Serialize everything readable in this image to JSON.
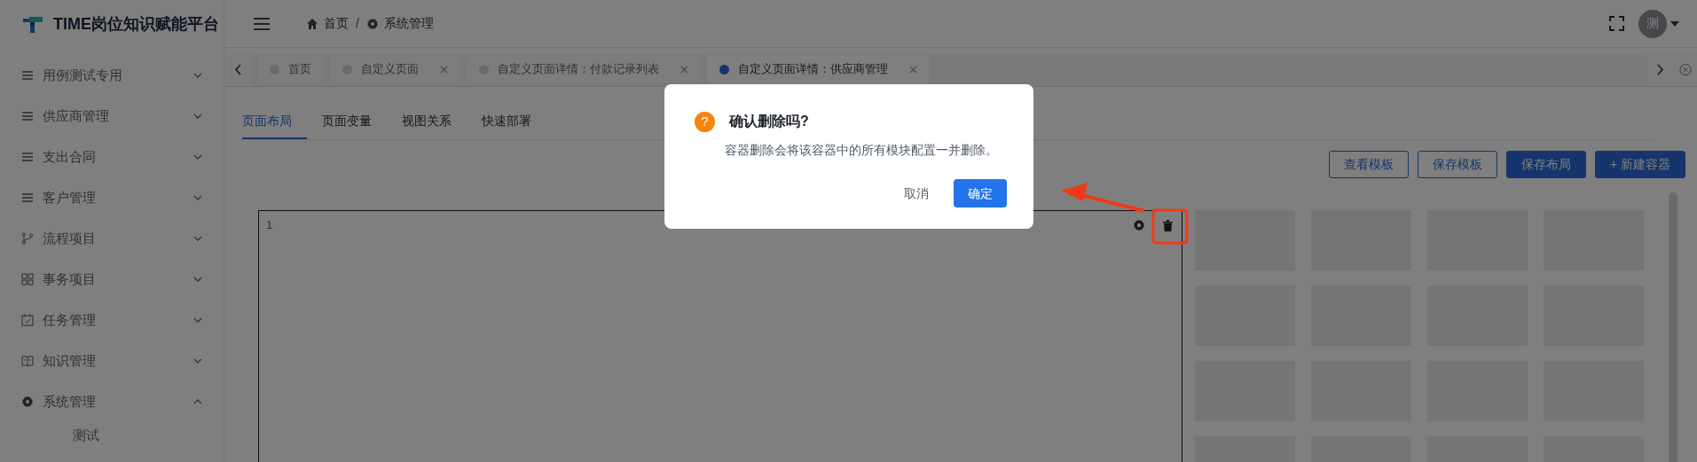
{
  "app": {
    "title": "TIME岗位知识赋能平台"
  },
  "sidebar": {
    "items": [
      {
        "label": "用例测试专用",
        "kind": "list",
        "expanded": false
      },
      {
        "label": "供应商管理",
        "kind": "list",
        "expanded": false
      },
      {
        "label": "支出合同",
        "kind": "list",
        "expanded": false
      },
      {
        "label": "客户管理",
        "kind": "list",
        "expanded": false
      },
      {
        "label": "流程项目",
        "kind": "branch",
        "expanded": false
      },
      {
        "label": "事务项目",
        "kind": "grid",
        "expanded": false
      },
      {
        "label": "任务管理",
        "kind": "calendar",
        "expanded": false
      },
      {
        "label": "知识管理",
        "kind": "book",
        "expanded": false
      },
      {
        "label": "系统管理",
        "kind": "gear",
        "expanded": true,
        "children": [
          {
            "label": "测试"
          }
        ]
      }
    ]
  },
  "breadcrumb": [
    {
      "label": "首页",
      "kind": "home"
    },
    {
      "separator": "/",
      "label": "系统管理",
      "kind": "gear"
    }
  ],
  "user": {
    "initial": "测"
  },
  "page_tabs": [
    {
      "label": "首页",
      "closable": false,
      "selected": false
    },
    {
      "label": "自定义页面",
      "closable": true,
      "selected": false
    },
    {
      "label": "自定义页面详情：付款记录列表",
      "closable": true,
      "selected": false
    },
    {
      "label": "自定义页面详情：供应商管理",
      "closable": true,
      "selected": true
    }
  ],
  "content_tabs": [
    {
      "label": "页面布局",
      "selected": true
    },
    {
      "label": "页面变量",
      "selected": false
    },
    {
      "label": "视图关系",
      "selected": false
    },
    {
      "label": "快速部署",
      "selected": false
    }
  ],
  "toolbar": [
    {
      "label": "查看模板",
      "kind": "outline"
    },
    {
      "label": "保存模板",
      "kind": "outline"
    },
    {
      "label": "保存布局",
      "kind": "primary"
    },
    {
      "label": "+ 新建容器",
      "kind": "primary"
    }
  ],
  "container": {
    "number": "1"
  },
  "dialog": {
    "icon": "?",
    "title": "确认删除吗?",
    "message": "容器删除会将该容器中的所有模块配置一并删除。",
    "buttons": [
      {
        "label": "取消",
        "kind": "text"
      },
      {
        "label": "确定",
        "kind": "primary"
      }
    ]
  }
}
